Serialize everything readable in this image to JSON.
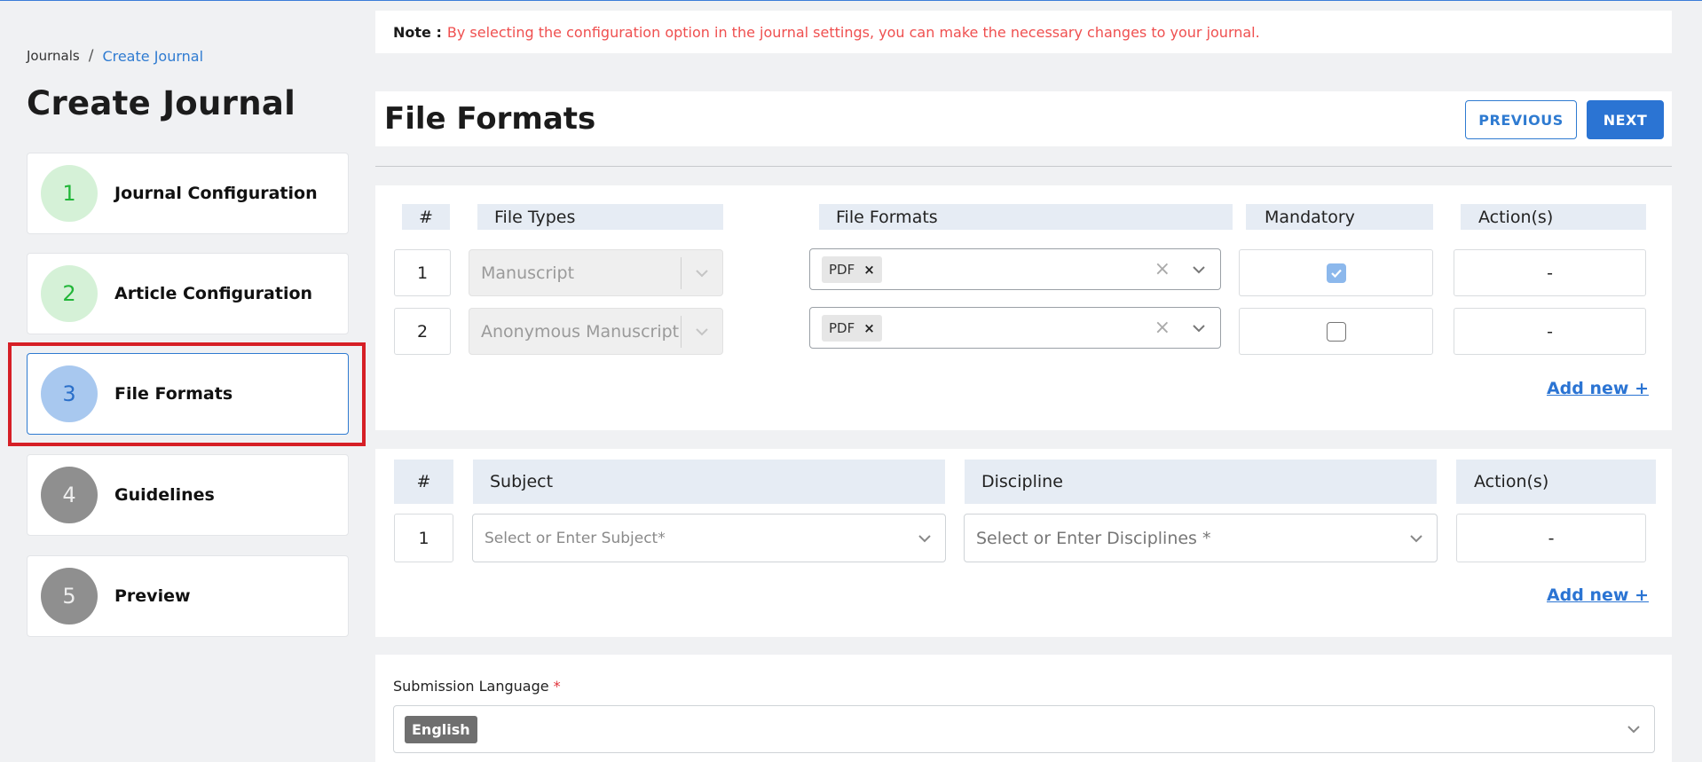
{
  "breadcrumb": {
    "root": "Journals",
    "separator": "/",
    "current": "Create Journal"
  },
  "page_title": "Create Journal",
  "steps": [
    {
      "number": "1",
      "label": "Journal Configuration",
      "state": "done"
    },
    {
      "number": "2",
      "label": "Article Configuration",
      "state": "done"
    },
    {
      "number": "3",
      "label": "File Formats",
      "state": "active"
    },
    {
      "number": "4",
      "label": "Guidelines",
      "state": "todo"
    },
    {
      "number": "5",
      "label": "Preview",
      "state": "todo"
    }
  ],
  "note": {
    "label": "Note :",
    "text": "By selecting the configuration option in the journal settings, you can make the necessary changes to your journal."
  },
  "header": {
    "title": "File Formats",
    "previous_label": "PREVIOUS",
    "next_label": "NEXT"
  },
  "file_formats_table": {
    "headers": {
      "num": "#",
      "file_types": "File Types",
      "file_formats": "File Formats",
      "mandatory": "Mandatory",
      "actions": "Action(s)"
    },
    "rows": [
      {
        "num": "1",
        "file_type": "Manuscript",
        "format_tag": "PDF",
        "mandatory": true,
        "action": "-"
      },
      {
        "num": "2",
        "file_type": "Anonymous Manuscript",
        "format_tag": "PDF",
        "mandatory": false,
        "action": "-"
      }
    ],
    "add_new": "Add new +"
  },
  "subject_table": {
    "headers": {
      "num": "#",
      "subject": "Subject",
      "discipline": "Discipline",
      "actions": "Action(s)"
    },
    "rows": [
      {
        "num": "1",
        "subject_placeholder": "Select or Enter Subject*",
        "discipline_placeholder": "Select or Enter Disciplines *",
        "action": "-"
      }
    ],
    "add_new": "Add new +"
  },
  "submission_language": {
    "label": "Submission Language",
    "required_mark": "*",
    "selected": "English"
  },
  "colors": {
    "accent": "#2b74d3",
    "note_red": "#ef4f4f",
    "done_green": "#22b639",
    "highlight_red": "#d61f26"
  },
  "icons": {
    "chevron": "chevron-down-icon",
    "clear": "clear-x-icon",
    "tag_remove": "tag-remove-icon",
    "check": "check-icon"
  }
}
